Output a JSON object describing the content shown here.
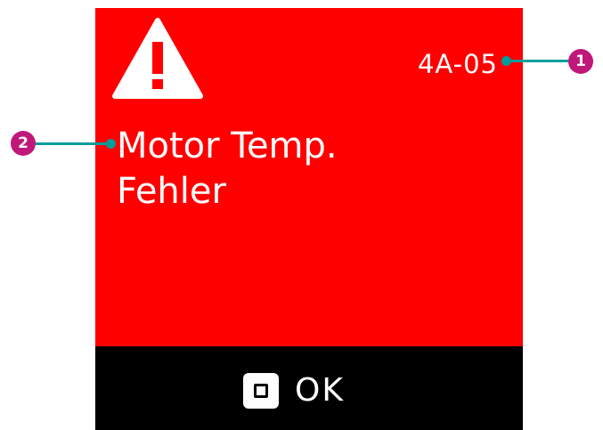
{
  "screen": {
    "error_code": "4A-05",
    "message_lines": [
      "Motor Temp.",
      "Fehler"
    ],
    "warning_icon": "warning-triangle-icon",
    "panel_color": "#ff0000"
  },
  "button_bar": {
    "ok_key_icon": "square-key-icon",
    "ok_label": "OK"
  },
  "callouts": [
    {
      "number": "1",
      "target": "error-code"
    },
    {
      "number": "2",
      "target": "error-message"
    }
  ],
  "colors": {
    "callout_line": "#009c9a",
    "callout_badge": "#c0187a"
  }
}
